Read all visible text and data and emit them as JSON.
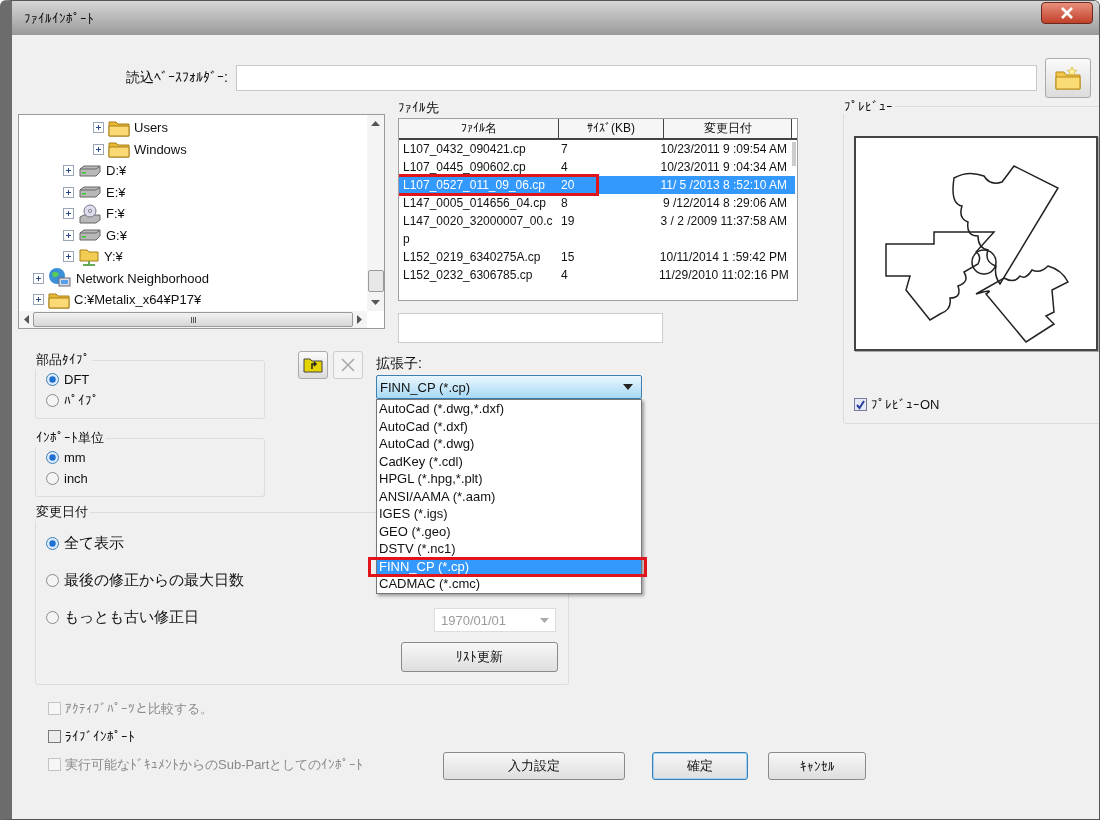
{
  "window": {
    "title": "ﾌｧｲﾙｲﾝﾎﾟｰﾄ"
  },
  "base_folder": {
    "label": "読込ﾍﾞｰｽﾌｫﾙﾀﾞｰ:"
  },
  "tree": {
    "items": [
      {
        "children": [
          {
            "children": [
              {
                "label": "Users",
                "kind": "folder",
                "expanded": false
              },
              {
                "label": "Windows",
                "kind": "folder",
                "expanded": false
              }
            ]
          },
          {
            "label": "D:¥",
            "kind": "drive",
            "expanded": false
          },
          {
            "label": "E:¥",
            "kind": "drive",
            "expanded": false
          },
          {
            "label": "F:¥",
            "kind": "disc",
            "expanded": false
          },
          {
            "label": "G:¥",
            "kind": "drive",
            "expanded": false
          },
          {
            "label": "Y:¥",
            "kind": "network-drive",
            "expanded": false
          }
        ]
      },
      {
        "label": "Network Neighborhood",
        "kind": "network",
        "expanded": false
      },
      {
        "label": "C:¥Metalix_x64¥P17¥",
        "kind": "folder",
        "expanded": false
      }
    ]
  },
  "files": {
    "label": "ﾌｧｲﾙ先",
    "columns": [
      "ﾌｧｲﾙ名",
      "ｻｲｽﾞ(KB)",
      "変更日付"
    ],
    "rows": [
      {
        "name": "L107_0432_090421.cp",
        "size": "7",
        "modified": "10/23/2011 9 :09:54 AM",
        "selected": false,
        "highlighted": false
      },
      {
        "name": "L107_0445_090602.cp",
        "size": "4",
        "modified": "10/23/2011 9 :04:34 AM",
        "selected": false,
        "highlighted": false
      },
      {
        "name": "L107_0527_011_09_06.cp",
        "size": "20",
        "modified": "11/ 5 /2013 8 :52:10 AM",
        "selected": true,
        "highlighted": true
      },
      {
        "name": "L147_0005_014656_04.cp",
        "size": "8",
        "modified": "9 /12/2014 8 :29:06 AM",
        "selected": false,
        "highlighted": false
      },
      {
        "name": "L147_0020_32000007_00.cp",
        "size": "19",
        "modified": "3 / 2 /2009 11:37:58 AM",
        "selected": false,
        "highlighted": false
      },
      {
        "name": "L152_0219_6340275A.cp",
        "size": "15",
        "modified": "10/11/2014 1 :59:42 PM",
        "selected": false,
        "highlighted": false
      },
      {
        "name": "L152_0232_6306785.cp",
        "size": "4",
        "modified": "11/29/2010 11:02:16 PM",
        "selected": false,
        "highlighted": false
      }
    ]
  },
  "folder_buttons": [
    {
      "kind": "up-folder",
      "disabled": false
    },
    {
      "kind": "delete",
      "disabled": true
    }
  ],
  "part_type": {
    "label": "部品ﾀｲﾌﾟ",
    "options": [
      {
        "label": "DFT",
        "selected": true
      },
      {
        "label": "ﾊﾟｲﾌﾟ",
        "selected": false
      }
    ]
  },
  "import_unit": {
    "label": "ｲﾝﾎﾟｰﾄ単位",
    "options": [
      {
        "label": "mm",
        "selected": true
      },
      {
        "label": "inch",
        "selected": false
      }
    ]
  },
  "extension": {
    "label": "拡張子:",
    "value": "FINN_CP (*.cp)",
    "expanded": true,
    "options": [
      {
        "label": "AutoCad (*.dwg,*.dxf)",
        "selected": false,
        "highlighted": false
      },
      {
        "label": "AutoCad (*.dxf)",
        "selected": false,
        "highlighted": false
      },
      {
        "label": "AutoCad (*.dwg)",
        "selected": false,
        "highlighted": false
      },
      {
        "label": "CadKey (*.cdl)",
        "selected": false,
        "highlighted": false
      },
      {
        "label": "HPGL (*.hpg,*.plt)",
        "selected": false,
        "highlighted": false
      },
      {
        "label": "ANSI/AAMA (*.aam)",
        "selected": false,
        "highlighted": false
      },
      {
        "label": "IGES (*.igs)",
        "selected": false,
        "highlighted": false
      },
      {
        "label": "GEO (*.geo)",
        "selected": false,
        "highlighted": false
      },
      {
        "label": "DSTV (*.nc1)",
        "selected": false,
        "highlighted": false
      },
      {
        "label": "FINN_CP (*.cp)",
        "selected": true,
        "highlighted": true
      },
      {
        "label": "CADMAC (*.cmc)",
        "selected": false,
        "highlighted": false
      }
    ]
  },
  "date_filter": {
    "label": "変更日付",
    "options": [
      {
        "label": "全て表示",
        "selected": true
      },
      {
        "label": "最後の修正からの最大日数",
        "selected": false
      },
      {
        "label": "もっとも古い修正日",
        "selected": false
      }
    ],
    "date": {
      "value": "1970/01/01",
      "disabled": true
    },
    "refresh_button": "ﾘｽﾄ更新"
  },
  "preview": {
    "label": "ﾌﾟﾚﾋﾞｭｰ",
    "checkbox": {
      "label": "ﾌﾟﾚﾋﾞｭｰON",
      "checked": true
    }
  },
  "options": [
    {
      "label": "ｱｸﾃｨﾌﾞﾊﾟｰﾂと比較する。",
      "checked": false,
      "disabled": true
    },
    {
      "label": "ﾗｲﾌﾞｲﾝﾎﾟｰﾄ",
      "checked": false,
      "disabled": false
    },
    {
      "label": "実行可能なﾄﾞｷｭﾒﾝﾄからのSub-Partとしてのｲﾝﾎﾟｰﾄ",
      "checked": false,
      "disabled": true
    }
  ],
  "buttons": [
    {
      "label": "入力設定",
      "default": false
    },
    {
      "label": "確定",
      "default": true
    },
    {
      "label": "ｷｬﾝｾﾙ",
      "default": false
    }
  ]
}
